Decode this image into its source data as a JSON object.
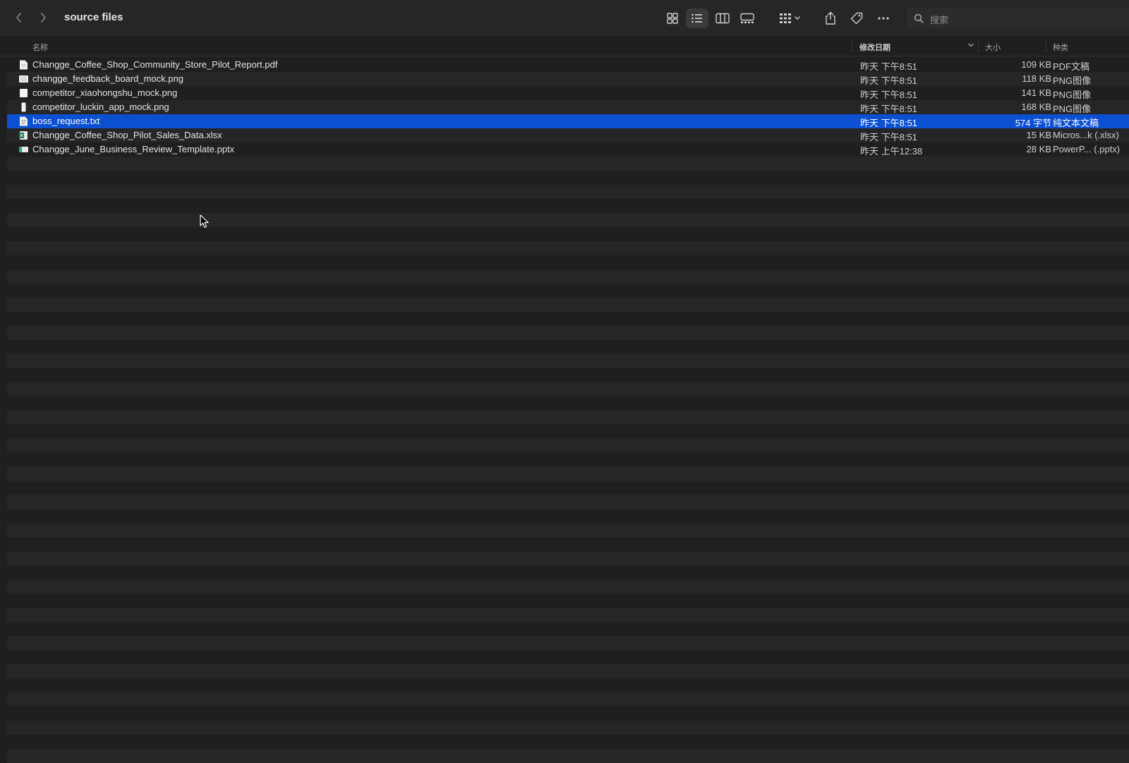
{
  "window": {
    "title": "source files",
    "search_placeholder": "搜索",
    "accent_color": "#0b50d0"
  },
  "toolbar": {
    "icons": [
      "chevron-left-icon",
      "chevron-right-icon",
      "grid-view-icon",
      "list-view-icon",
      "column-view-icon",
      "gallery-view-icon",
      "group-icon",
      "share-icon",
      "tag-icon",
      "more-icon",
      "search-icon"
    ],
    "active_view": "list"
  },
  "columns": {
    "name": "名称",
    "date": "修改日期",
    "size": "大小",
    "kind": "种类"
  },
  "files": [
    {
      "name": "Changge_Coffee_Shop_Community_Store_Pilot_Report.pdf",
      "date": "昨天 下午8:51",
      "size": "109 KB",
      "kind": "PDF文稿",
      "icon": "pdf-file-icon"
    },
    {
      "name": "changge_feedback_board_mock.png",
      "date": "昨天 下午8:51",
      "size": "118 KB",
      "kind": "PNG图像",
      "icon": "image-file-icon"
    },
    {
      "name": "competitor_xiaohongshu_mock.png",
      "date": "昨天 下午8:51",
      "size": "141 KB",
      "kind": "PNG图像",
      "icon": "image-file-icon"
    },
    {
      "name": "competitor_luckin_app_mock.png",
      "date": "昨天 下午8:51",
      "size": "168 KB",
      "kind": "PNG图像",
      "icon": "image-file-icon"
    },
    {
      "name": "boss_request.txt",
      "date": "昨天 下午8:51",
      "size": "574 字节",
      "kind": "纯文本文稿",
      "icon": "text-file-icon",
      "selected": true
    },
    {
      "name": "Changge_Coffee_Shop_Pilot_Sales_Data.xlsx",
      "date": "昨天 下午8:51",
      "size": "15 KB",
      "kind": "Micros...k (.xlsx)",
      "icon": "excel-file-icon"
    },
    {
      "name": "Changge_June_Business_Review_Template.pptx",
      "date": "昨天 上午12:38",
      "size": "28 KB",
      "kind": "PowerP... (.pptx)",
      "icon": "powerpoint-file-icon"
    }
  ]
}
